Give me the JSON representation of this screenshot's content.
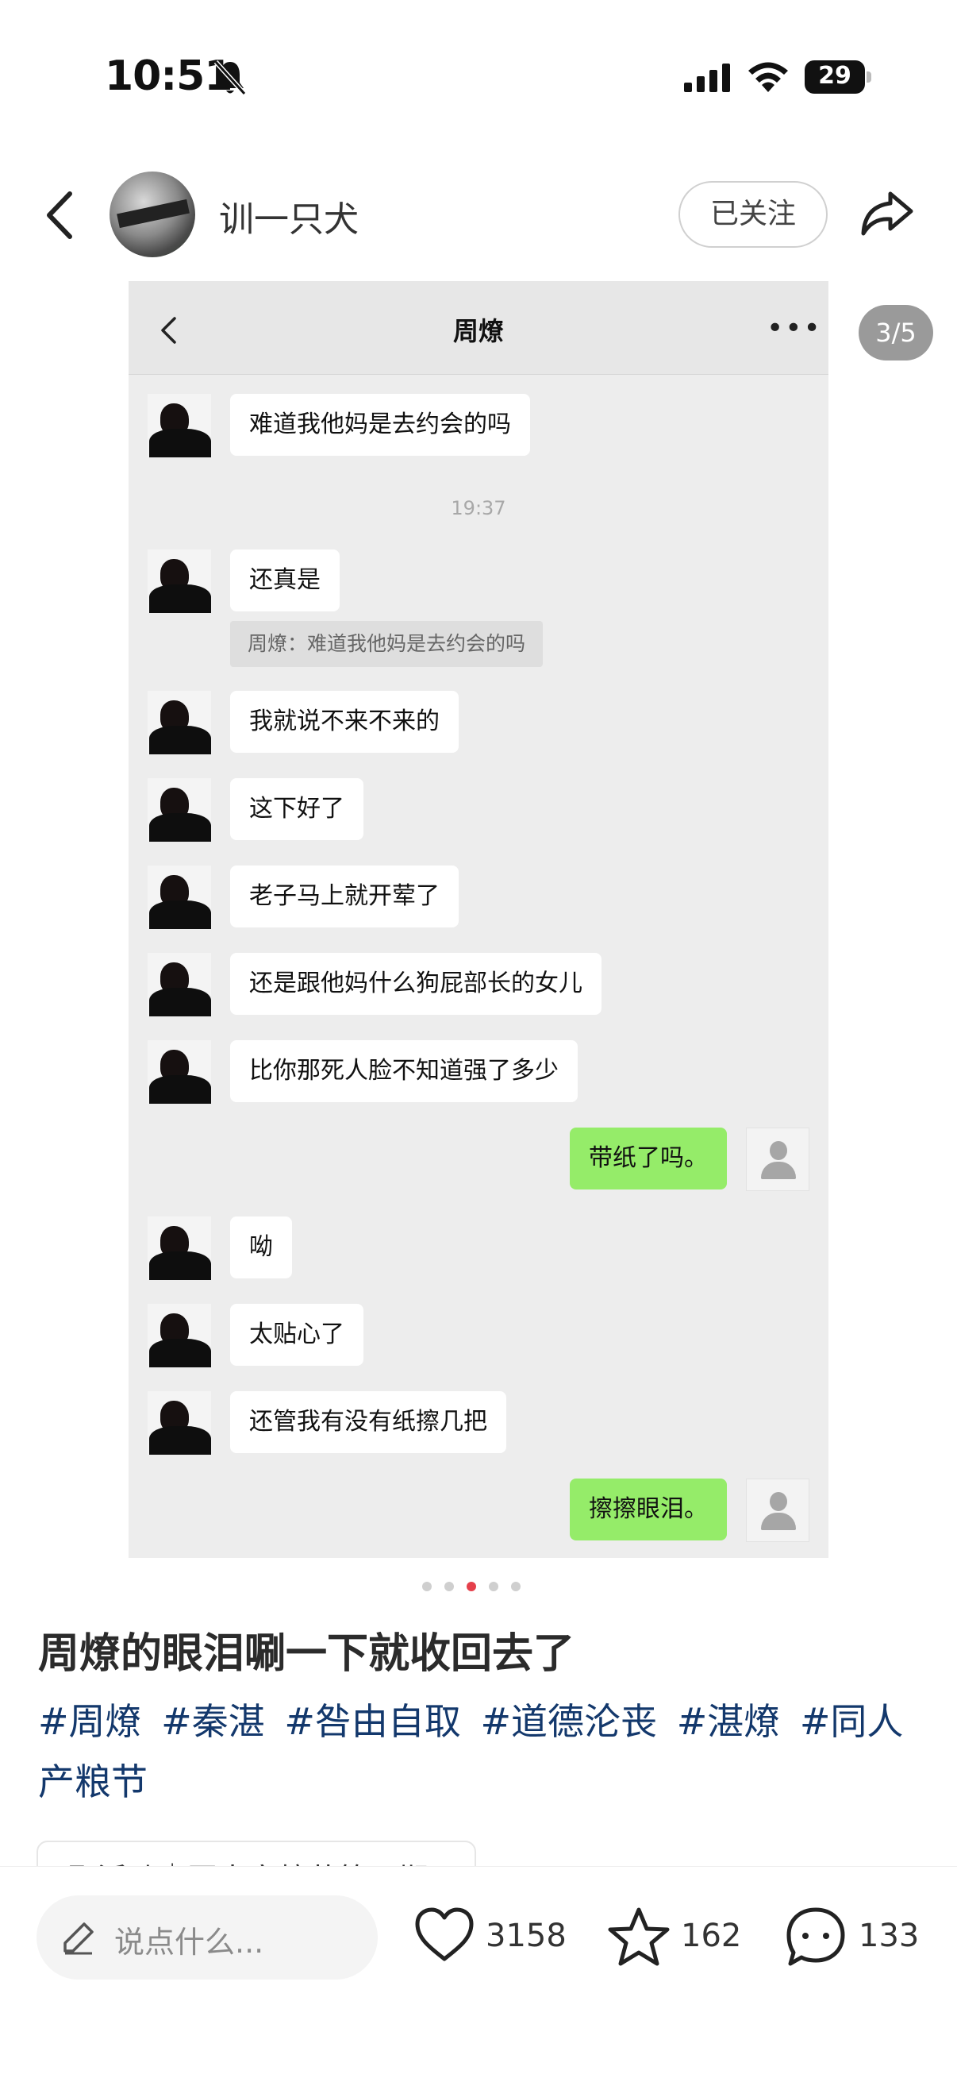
{
  "status_bar": {
    "time": "10:51",
    "battery": "29"
  },
  "header": {
    "username": "训一只犬",
    "follow_label": "已关注"
  },
  "chat": {
    "title": "周燎",
    "time_divider": "19:37",
    "quote": "周燎：难道我他妈是去约会的吗",
    "messages": [
      "难道我他妈是去约会的吗",
      "还真是",
      "我就说不来不来的",
      "这下好了",
      "老子马上就开荤了",
      "还是跟他妈什么狗屁部长的女儿",
      "比你那死人脸不知道强了多少",
      "带纸了吗。",
      "呦",
      "太贴心了",
      "还管我有没有纸擦几把",
      "擦擦眼泪。"
    ]
  },
  "page_counter": "3/5",
  "carousel": {
    "total": 5,
    "active": 3
  },
  "post": {
    "title": "周燎的眼泪唰一下就收回去了",
    "tags": [
      "#周燎",
      "#秦湛",
      "#咎由自取",
      "#道德沦丧",
      "#湛燎",
      "#同人产粮节"
    ],
    "activity": "唱 活动｜同人产粮节第四期"
  },
  "bottom_bar": {
    "comment_placeholder": "说点什么...",
    "likes": "3158",
    "favorites": "162",
    "comments": "133"
  },
  "colors": {
    "tag": "#13386c",
    "my_bubble": "#95ec69",
    "active_dot": "#e5404b"
  }
}
